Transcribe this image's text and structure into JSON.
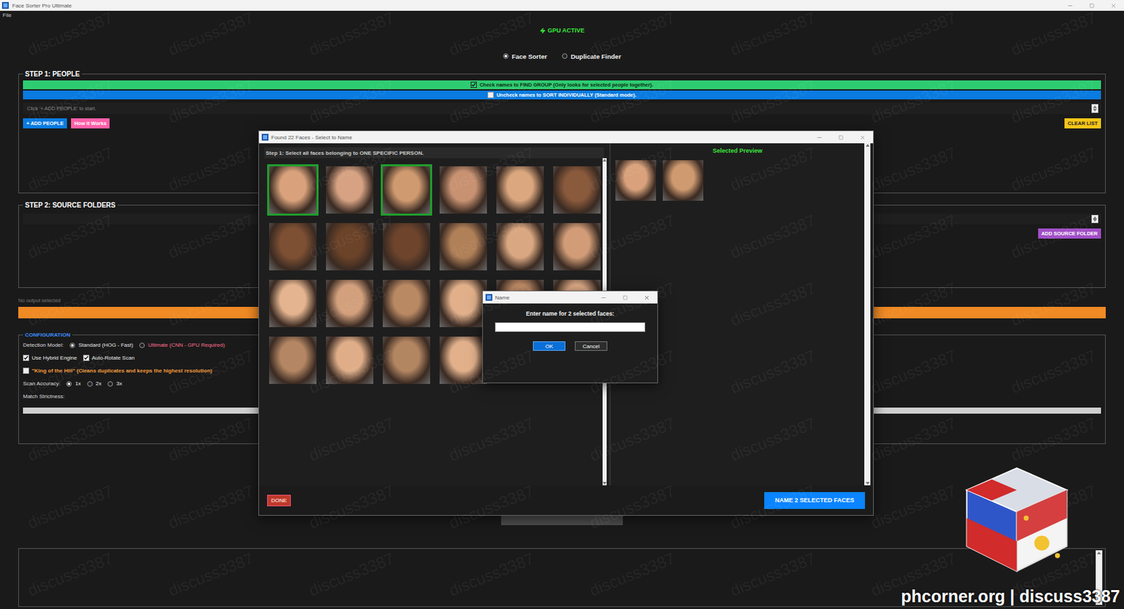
{
  "window": {
    "title": "Face Sorter Pro Ultimate"
  },
  "menu": [
    "File"
  ],
  "gpu_status": "GPU ACTIVE",
  "modes": [
    {
      "label": "Face Sorter",
      "selected": true
    },
    {
      "label": "Duplicate Finder",
      "selected": false
    }
  ],
  "step1": {
    "title": "STEP 1: PEOPLE",
    "group_bar": {
      "label": "Check names to FIND GROUP (Only looks for selected people together).",
      "checked": true
    },
    "individual_bar": {
      "label": "Uncheck names to SORT INDIVIDUALLY (Standard mode).",
      "checked": false
    },
    "placeholder": "Click '+ ADD PEOPLE' to start.",
    "add_button": "+ ADD PEOPLE",
    "help_button": "How it Works",
    "clear_button": "CLEAR LIST"
  },
  "step2": {
    "title": "STEP 2: SOURCE FOLDERS",
    "add_button": "ADD SOURCE FOLDER"
  },
  "output": {
    "label": "No output selected"
  },
  "config": {
    "title": "CONFIGURATION",
    "detection": {
      "label": "Detection Model:",
      "options": [
        {
          "label": "Standard (HOG - Fast)",
          "selected": true,
          "color": "#e6e6e6"
        },
        {
          "label": "Ultimate (CNN - GPU Required)",
          "selected": false,
          "color": "#ff6f91"
        }
      ]
    },
    "engines": [
      {
        "label": "Use Hybrid Engine",
        "checked": true
      },
      {
        "label": "Auto-Rotate Scan",
        "checked": true
      }
    ],
    "king": {
      "label": "\"King of the Hill\" (Cleans duplicates and keeps the highest resolution)",
      "checked": false
    },
    "accuracy": {
      "label": "Scan Accuracy:",
      "options": [
        {
          "label": "1x",
          "selected": true
        },
        {
          "label": "2x",
          "selected": false
        },
        {
          "label": "3x",
          "selected": false
        }
      ]
    },
    "strictness": {
      "label": "Match Strictness:",
      "level": 0.5
    }
  },
  "face_dialog": {
    "title": "Found 22 Faces - Select to Name",
    "instruction": "Step 1: Select all faces belonging to ONE SPECIFIC PERSON.",
    "preview_title": "Selected Preview",
    "faces": [
      {
        "selected": true
      },
      {
        "selected": false
      },
      {
        "selected": true
      },
      {
        "selected": false
      },
      {
        "selected": false
      },
      {
        "selected": false
      },
      {
        "selected": false
      },
      {
        "selected": false
      },
      {
        "selected": false
      },
      {
        "selected": false
      },
      {
        "selected": false
      },
      {
        "selected": false
      },
      {
        "selected": false
      },
      {
        "selected": false
      },
      {
        "selected": false
      },
      {
        "selected": false
      },
      {
        "selected": false
      },
      {
        "selected": false
      },
      {
        "selected": false
      },
      {
        "selected": false
      },
      {
        "selected": false
      },
      {
        "selected": false
      }
    ],
    "done_button": "DONE",
    "name_button": "NAME 2 SELECTED FACES"
  },
  "name_dialog": {
    "title": "Name",
    "prompt": "Enter name for 2 selected faces:",
    "value": "",
    "buttons": [
      {
        "label": "OK",
        "primary": true
      },
      {
        "label": "Cancel",
        "primary": false
      }
    ]
  },
  "watermark": "discuss3387",
  "brand": "phcorner.org | discuss3387"
}
